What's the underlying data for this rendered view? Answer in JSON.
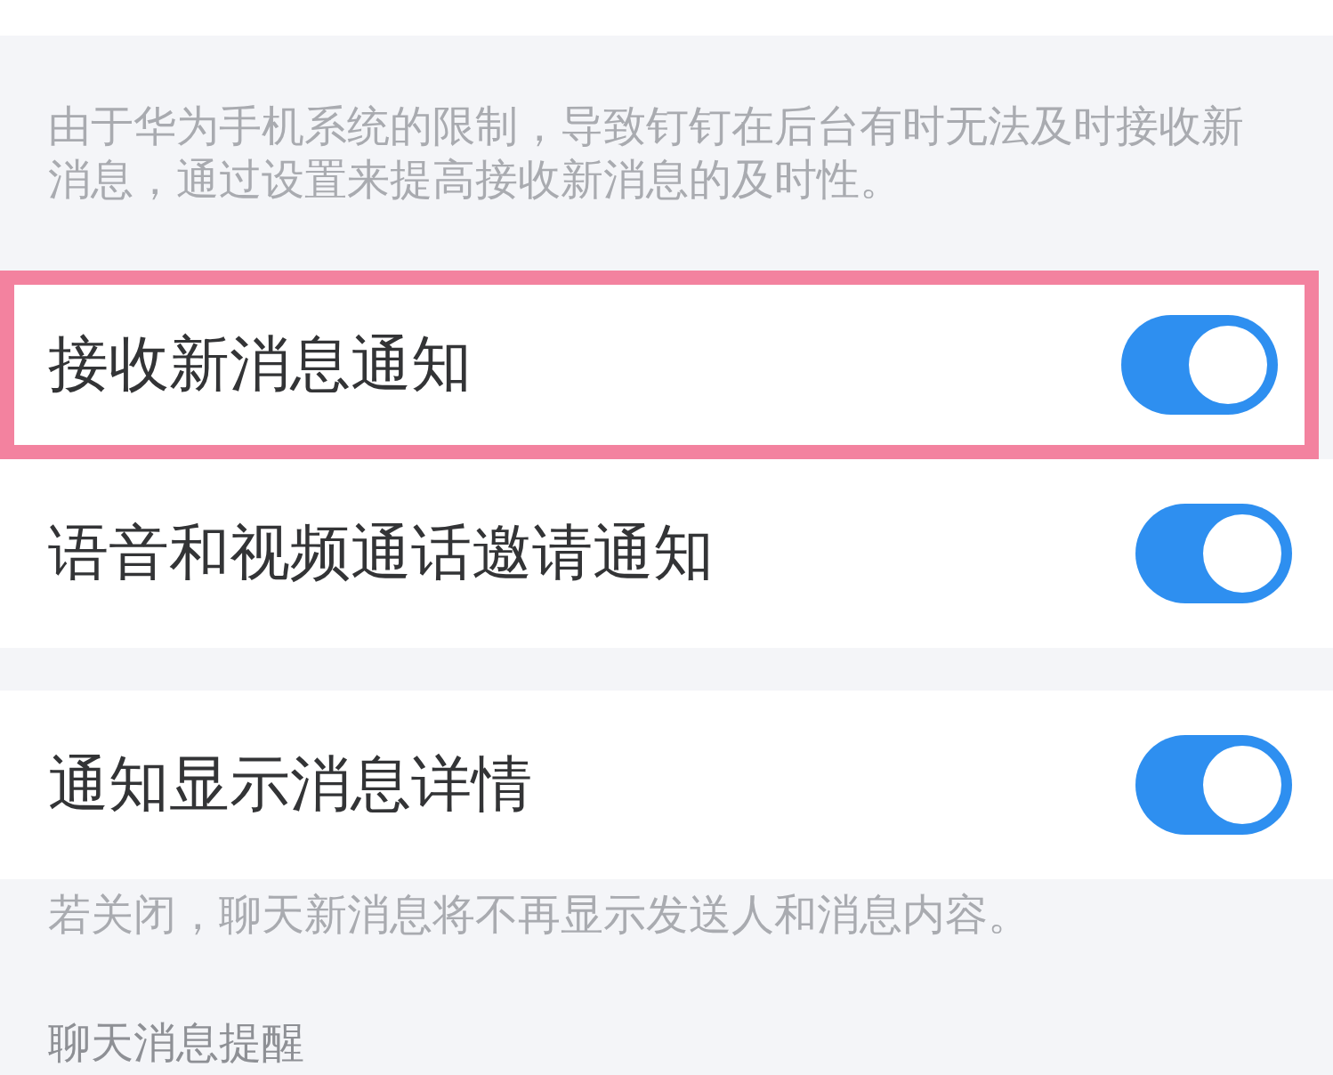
{
  "notice": "由于华为手机系统的限制，导致钉钉在后台有时无法及时接收新消息，通过设置来提高接收新消息的及时性。",
  "groups": [
    {
      "items": [
        {
          "label": "接收新消息通知",
          "on": true,
          "highlighted": true
        },
        {
          "label": "语音和视频通话邀请通知",
          "on": true,
          "highlighted": false
        }
      ]
    },
    {
      "items": [
        {
          "label": "通知显示消息详情",
          "on": true,
          "highlighted": false
        }
      ],
      "note": "若关闭，聊天新消息将不再显示发送人和消息内容。"
    }
  ],
  "section_header": "聊天消息提醒"
}
